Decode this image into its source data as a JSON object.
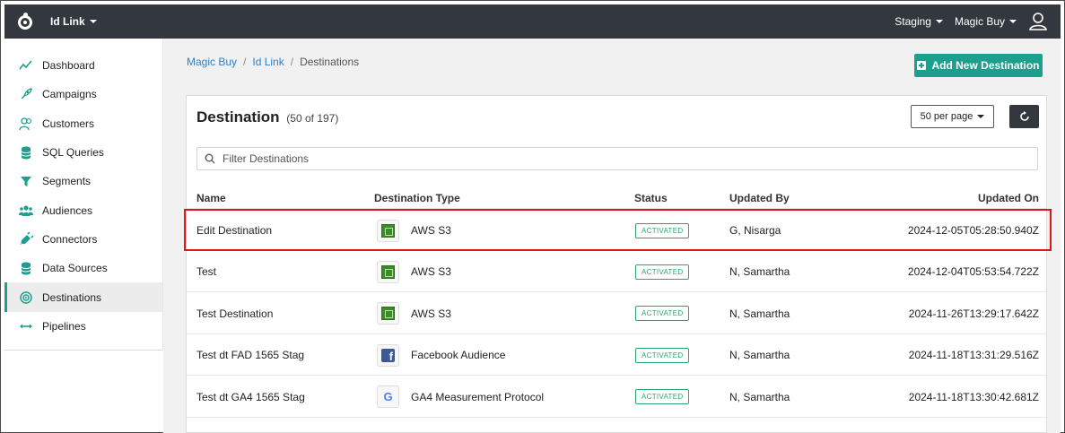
{
  "topbar": {
    "app_name": "Id Link",
    "environment": "Staging",
    "account": "Magic Buy",
    "user_icon": "user-icon"
  },
  "sidebar": {
    "items": [
      {
        "label": "Dashboard",
        "icon": "line-chart-icon"
      },
      {
        "label": "Campaigns",
        "icon": "rocket-icon"
      },
      {
        "label": "Customers",
        "icon": "users-outline-icon"
      },
      {
        "label": "SQL Queries",
        "icon": "database-icon"
      },
      {
        "label": "Segments",
        "icon": "filter-icon"
      },
      {
        "label": "Audiences",
        "icon": "users-icon"
      },
      {
        "label": "Connectors",
        "icon": "plug-icon"
      },
      {
        "label": "Data Sources",
        "icon": "database-icon"
      },
      {
        "label": "Destinations",
        "icon": "target-icon",
        "active": true
      },
      {
        "label": "Pipelines",
        "icon": "arrows-horizontal-icon"
      }
    ]
  },
  "breadcrumb": {
    "items": [
      "Magic Buy",
      "Id Link",
      "Destinations"
    ]
  },
  "actions": {
    "add_label": "Add New Destination"
  },
  "card": {
    "title": "Destination",
    "count": "(50 of 197)",
    "per_page": "50 per page",
    "filter_placeholder": "Filter Destinations"
  },
  "table": {
    "columns": [
      "Name",
      "Destination Type",
      "Status",
      "Updated By",
      "Updated On"
    ],
    "rows": [
      {
        "name": "Edit Destination",
        "type": "AWS S3",
        "type_icon": "aws-s3-icon",
        "status": "ACTIVATED",
        "updated_by": "G, Nisarga",
        "updated_on": "2024-12-05T05:28:50.940Z",
        "highlighted": true
      },
      {
        "name": "Test",
        "type": "AWS S3",
        "type_icon": "aws-s3-icon",
        "status": "ACTIVATED",
        "updated_by": "N, Samartha",
        "updated_on": "2024-12-04T05:53:54.722Z"
      },
      {
        "name": "Test Destination",
        "type": "AWS S3",
        "type_icon": "aws-s3-icon",
        "status": "ACTIVATED",
        "updated_by": "N, Samartha",
        "updated_on": "2024-11-26T13:29:17.642Z"
      },
      {
        "name": "Test dt FAD 1565 Stag",
        "type": "Facebook Audience",
        "type_icon": "facebook-icon",
        "status": "ACTIVATED",
        "updated_by": "N, Samartha",
        "updated_on": "2024-11-18T13:31:29.516Z"
      },
      {
        "name": "Test dt GA4 1565 Stag",
        "type": "GA4 Measurement Protocol",
        "type_icon": "google-icon",
        "status": "ACTIVATED",
        "updated_by": "N, Samartha",
        "updated_on": "2024-11-18T13:30:42.681Z"
      }
    ]
  },
  "colors": {
    "accent": "#1e9f8e",
    "topbar": "#32383e",
    "link": "#2f7fc1",
    "status": "#2aa76a",
    "highlight": "#e0161b"
  }
}
